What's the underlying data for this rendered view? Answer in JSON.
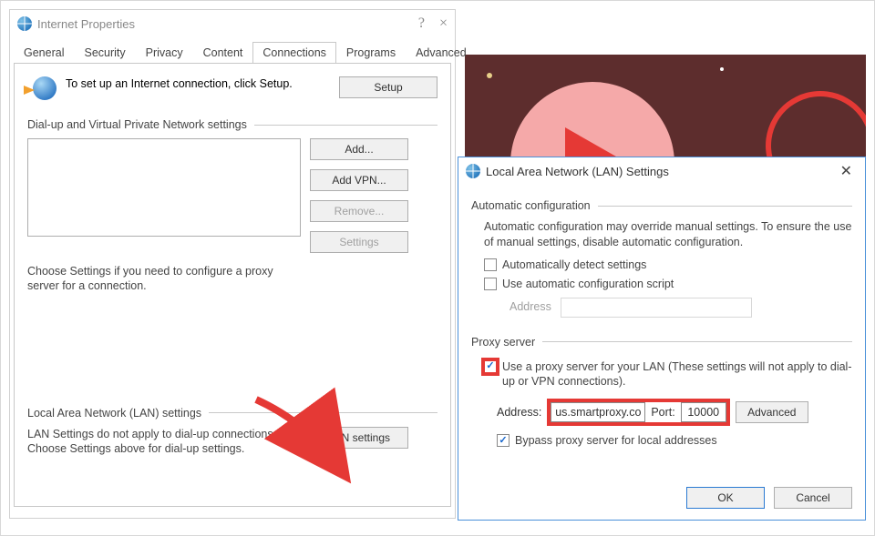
{
  "ip": {
    "title": "Internet Properties",
    "help": "?",
    "close": "×",
    "tabs": [
      "General",
      "Security",
      "Privacy",
      "Content",
      "Connections",
      "Programs",
      "Advanced"
    ],
    "setup_text": "To set up an Internet connection, click Setup.",
    "setup_btn": "Setup",
    "dialup_heading": "Dial-up and Virtual Private Network settings",
    "add_btn": "Add...",
    "addvpn_btn": "Add VPN...",
    "remove_btn": "Remove...",
    "settings_btn": "Settings",
    "proxy_note": "Choose Settings if you need to configure a proxy server for a connection.",
    "lan_heading": "Local Area Network (LAN) settings",
    "lan_note": "LAN Settings do not apply to dial-up connections. Choose Settings above for dial-up settings.",
    "lan_btn": "LAN settings"
  },
  "lan": {
    "title": "Local Area Network (LAN) Settings",
    "auto_heading": "Automatic configuration",
    "auto_text": "Automatic configuration may override manual settings.  To ensure the use of manual settings, disable automatic configuration.",
    "auto_detect": "Automatically detect settings",
    "auto_script": "Use automatic configuration script",
    "address_label_disabled": "Address",
    "proxy_heading": "Proxy server",
    "proxy_use": "Use a proxy server for your LAN (These settings will not apply to dial-up or VPN connections).",
    "addr_label": "Address:",
    "addr_value": "us.smartproxy.co",
    "port_label": "Port:",
    "port_value": "10000",
    "advanced_btn": "Advanced",
    "bypass": "Bypass proxy server for local addresses",
    "ok": "OK",
    "cancel": "Cancel"
  }
}
